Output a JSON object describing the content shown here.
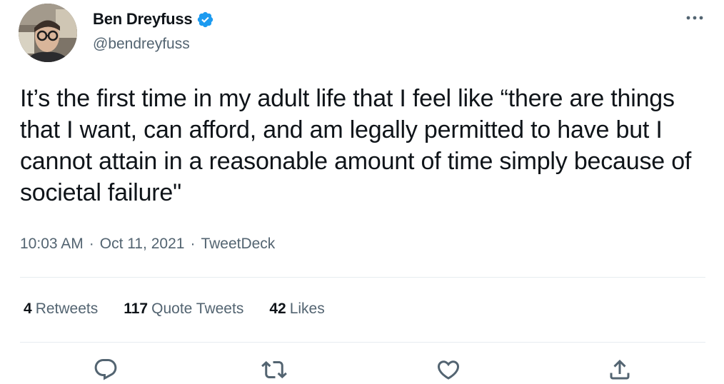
{
  "author": {
    "name": "Ben Dreyfuss",
    "handle": "@bendreyfuss",
    "verified": true,
    "verified_color": "#1d9bf0"
  },
  "tweet": {
    "text": "It’s the first time in my adult life that I feel like “there are things that I want, can afford, and am legally permitted to have but I cannot attain in a reasonable amount of time simply because of societal failure\"",
    "time": "10:03 AM",
    "date": "Oct 11, 2021",
    "source": "TweetDeck",
    "separator": "·"
  },
  "stats": {
    "retweets_count": "4",
    "retweets_label": "Retweets",
    "quote_tweets_count": "117",
    "quote_tweets_label": "Quote Tweets",
    "likes_count": "42",
    "likes_label": "Likes"
  },
  "actions": {
    "reply_icon": "reply-icon",
    "retweet_icon": "retweet-icon",
    "like_icon": "heart-icon",
    "share_icon": "share-icon"
  },
  "colors": {
    "text_primary": "#0f1419",
    "text_secondary": "#536471",
    "divider": "#e6ecf0"
  }
}
